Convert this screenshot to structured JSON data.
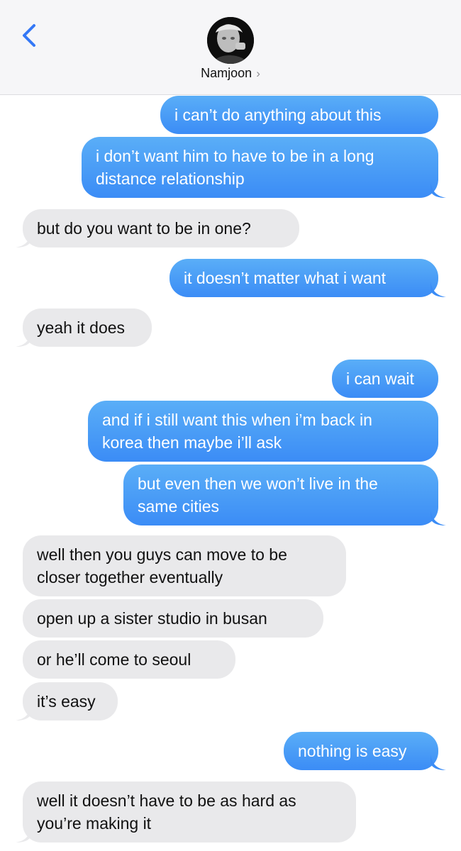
{
  "header": {
    "contact_name": "Namjoon",
    "chevron": "›",
    "back_icon": "chevron-left-icon",
    "accent": "#3478f6"
  },
  "colors": {
    "outgoing_top": "#5aaef7",
    "outgoing_bottom": "#3b8cf6",
    "incoming": "#e9e9eb"
  },
  "messages": [
    {
      "side": "out",
      "text": "i can’t do anything about this"
    },
    {
      "side": "out",
      "text": "i don’t want him to have to be in a long\ndistance relationship"
    },
    {
      "side": "in",
      "text": "but do you want to be in one?"
    },
    {
      "side": "out",
      "text": "it doesn’t matter what i want"
    },
    {
      "side": "in",
      "text": "yeah it does"
    },
    {
      "side": "out",
      "text": "i can wait"
    },
    {
      "side": "out",
      "text": "and if i still want this when i’m back in\nkorea then maybe i’ll ask"
    },
    {
      "side": "out",
      "text": "but even then we won’t live in the\nsame cities"
    },
    {
      "side": "in",
      "text": "well then you guys can move to be\ncloser together eventually"
    },
    {
      "side": "in",
      "text": "open up a sister studio in busan"
    },
    {
      "side": "in",
      "text": "or he’ll come to seoul"
    },
    {
      "side": "in",
      "text": "it’s easy"
    },
    {
      "side": "out",
      "text": "nothing is easy"
    },
    {
      "side": "in",
      "text": "well it doesn’t have to be as hard as\nyou’re making it"
    }
  ]
}
